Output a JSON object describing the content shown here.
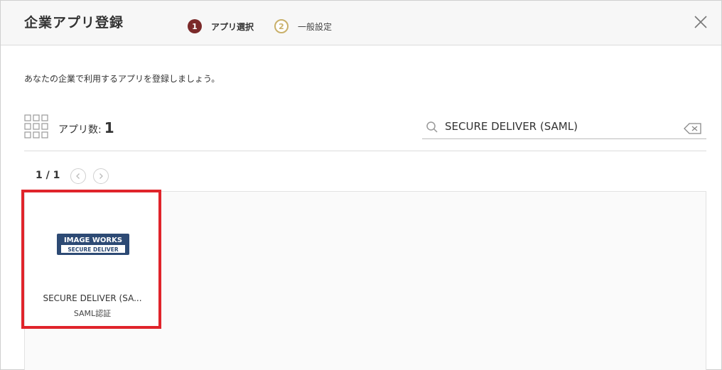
{
  "header": {
    "title": "企業アプリ登録",
    "steps": [
      {
        "num": "1",
        "label": "アプリ選択"
      },
      {
        "num": "2",
        "label": "一般設定"
      }
    ]
  },
  "main": {
    "description": "あなたの企業で利用するアプリを登録しましょう。",
    "count_label": "アプリ数:",
    "count_value": "1",
    "search_value": "SECURE DELIVER (SAML)",
    "pager": "1 / 1"
  },
  "apps": [
    {
      "name": "SECURE DELIVER (SA...",
      "sub": "SAML認証",
      "logo_top": "IMAGE WORKS",
      "logo_bottom": "SECURE DELIVER"
    }
  ],
  "colors": {
    "step_active": "#7b2a2a",
    "step_inactive": "#c9b06a",
    "highlight": "#e0242b",
    "logo": "#2d4a74"
  }
}
